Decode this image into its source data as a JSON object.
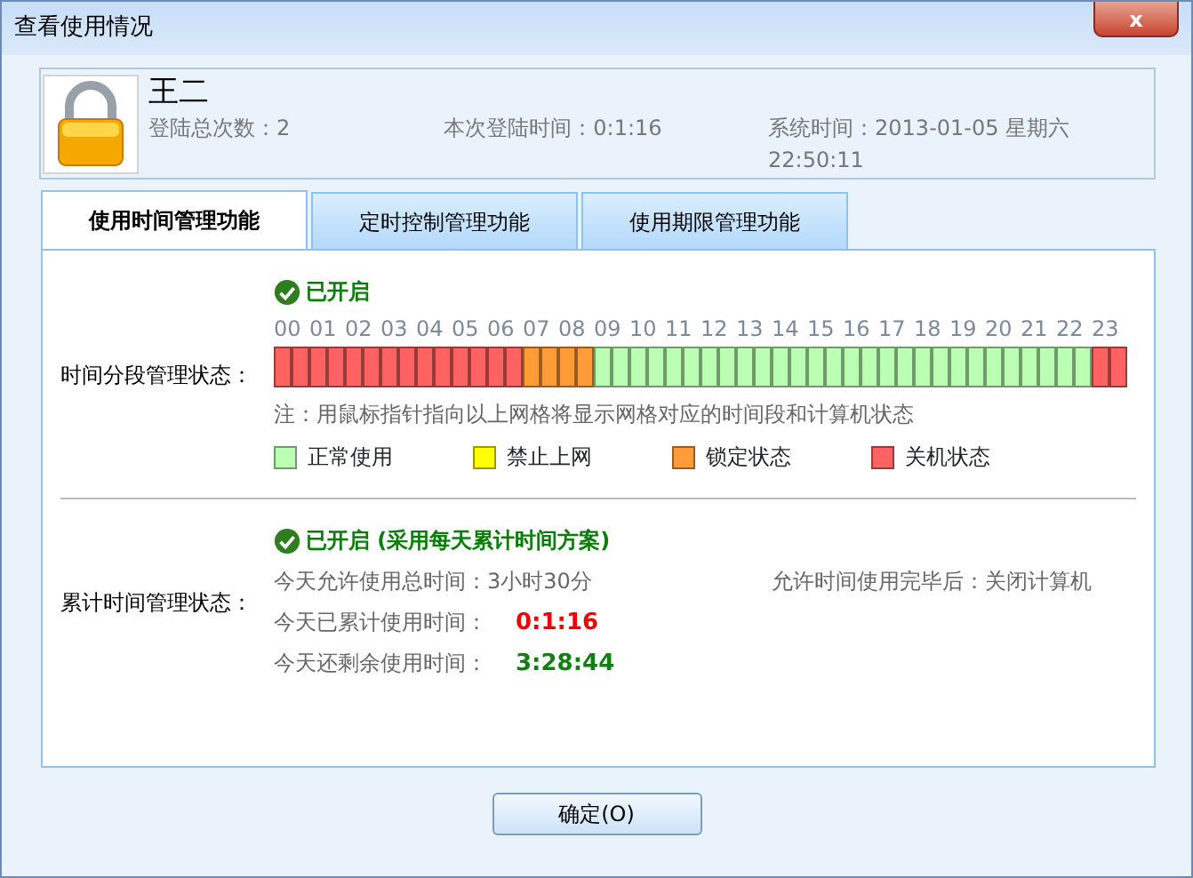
{
  "window": {
    "title": "查看使用情况",
    "close_label": "x"
  },
  "user": {
    "name": "王二",
    "login_count": "登陆总次数：2",
    "login_time": "本次登陆时间：0:1:16",
    "system_time": "系统时间：2013-01-05 星期六 22:50:11"
  },
  "tabs": [
    {
      "label": "使用时间管理功能",
      "selected": true
    },
    {
      "label": "定时控制管理功能",
      "selected": false
    },
    {
      "label": "使用期限管理功能",
      "selected": false
    }
  ],
  "period": {
    "label": "时间分段管理状态：",
    "status": "已开启",
    "hours": [
      "00",
      "01",
      "02",
      "03",
      "04",
      "05",
      "06",
      "07",
      "08",
      "09",
      "10",
      "11",
      "12",
      "13",
      "14",
      "15",
      "16",
      "17",
      "18",
      "19",
      "20",
      "21",
      "22",
      "23"
    ],
    "cells": [
      {
        "color": "#ff6262"
      },
      {
        "color": "#ff6262"
      },
      {
        "color": "#ff6262"
      },
      {
        "color": "#ff6262"
      },
      {
        "color": "#ff6262"
      },
      {
        "color": "#ff6262"
      },
      {
        "color": "#ff6262"
      },
      {
        "color": "#ff6262"
      },
      {
        "color": "#ff6262"
      },
      {
        "color": "#ff6262"
      },
      {
        "color": "#ff6262"
      },
      {
        "color": "#ff6262"
      },
      {
        "color": "#ff6262"
      },
      {
        "color": "#ff6262"
      },
      {
        "color": "#ff9c38"
      },
      {
        "color": "#ff9c38"
      },
      {
        "color": "#ff9c38"
      },
      {
        "color": "#ff9c38"
      },
      {
        "color": "#bbffb5"
      },
      {
        "color": "#bbffb5"
      },
      {
        "color": "#bbffb5"
      },
      {
        "color": "#bbffb5"
      },
      {
        "color": "#bbffb5"
      },
      {
        "color": "#bbffb5"
      },
      {
        "color": "#bbffb5"
      },
      {
        "color": "#bbffb5"
      },
      {
        "color": "#bbffb5"
      },
      {
        "color": "#bbffb5"
      },
      {
        "color": "#bbffb5"
      },
      {
        "color": "#bbffb5"
      },
      {
        "color": "#bbffb5"
      },
      {
        "color": "#bbffb5"
      },
      {
        "color": "#bbffb5"
      },
      {
        "color": "#bbffb5"
      },
      {
        "color": "#bbffb5"
      },
      {
        "color": "#bbffb5"
      },
      {
        "color": "#bbffb5"
      },
      {
        "color": "#bbffb5"
      },
      {
        "color": "#bbffb5"
      },
      {
        "color": "#bbffb5"
      },
      {
        "color": "#bbffb5"
      },
      {
        "color": "#bbffb5"
      },
      {
        "color": "#bbffb5"
      },
      {
        "color": "#bbffb5"
      },
      {
        "color": "#bbffb5"
      },
      {
        "color": "#bbffb5"
      },
      {
        "color": "#ff6262"
      },
      {
        "color": "#ff6262"
      }
    ],
    "note": "注：用鼠标指针指向以上网格将显示网格对应的时间段和计算机状态",
    "legend": [
      {
        "label": "正常使用",
        "color": "#bbffb5"
      },
      {
        "label": "禁止上网",
        "color": "#ffff00"
      },
      {
        "label": "锁定状态",
        "color": "#ff9c38"
      },
      {
        "label": "关机状态",
        "color": "#ff6262"
      }
    ]
  },
  "cumulative": {
    "label": "累计时间管理状态：",
    "status": "已开启 (采用每天累计时间方案)",
    "allowed": "今天允许使用总时间：3小时30分",
    "after": "允许时间使用完毕后：关闭计算机",
    "used_label": "今天已累计使用时间：",
    "used": "0:1:16",
    "remaining_label": "今天还剩余使用时间：",
    "remaining": "3:28:44"
  },
  "ok_button": "确定(O)"
}
